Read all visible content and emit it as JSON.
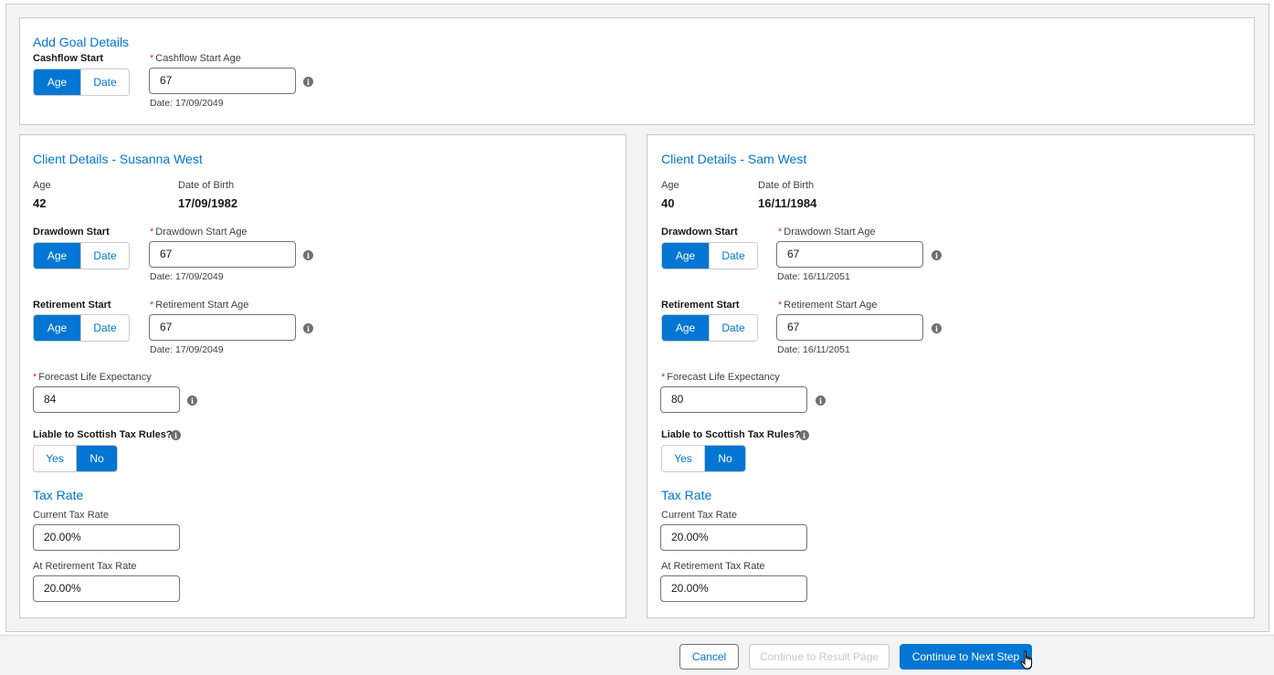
{
  "goal": {
    "title": "Add Goal Details",
    "cashflow_start_label": "Cashflow Start",
    "toggle": {
      "option1": "Age",
      "option2": "Date",
      "selected": "Age"
    },
    "age_label": "Cashflow Start Age",
    "age_value": "67",
    "date_hint": "Date: 17/09/2049"
  },
  "clients": [
    {
      "title": "Client Details - Susanna West",
      "age_label": "Age",
      "age": "42",
      "dob_label": "Date of Birth",
      "dob": "17/09/1982",
      "drawdown_label": "Drawdown Start",
      "drawdown_toggle": {
        "option1": "Age",
        "option2": "Date",
        "selected": "Age"
      },
      "drawdown_age_label": "Drawdown Start Age",
      "drawdown_age": "67",
      "drawdown_date_hint": "Date: 17/09/2049",
      "retirement_label": "Retirement Start",
      "retirement_toggle": {
        "option1": "Age",
        "option2": "Date",
        "selected": "Age"
      },
      "retirement_age_label": "Retirement Start Age",
      "retirement_age": "67",
      "retirement_date_hint": "Date: 17/09/2049",
      "life_expectancy_label": "Forecast Life Expectancy",
      "life_expectancy": "84",
      "scottish_label": "Liable to Scottish Tax Rules?",
      "scottish_toggle": {
        "option1": "Yes",
        "option2": "No",
        "selected": "No"
      },
      "tax_title": "Tax Rate",
      "current_tax_label": "Current Tax Rate",
      "current_tax": "20.00%",
      "retirement_tax_label": "At Retirement Tax Rate",
      "retirement_tax": "20.00%"
    },
    {
      "title": "Client Details - Sam West",
      "age_label": "Age",
      "age": "40",
      "dob_label": "Date of Birth",
      "dob": "16/11/1984",
      "drawdown_label": "Drawdown Start",
      "drawdown_toggle": {
        "option1": "Age",
        "option2": "Date",
        "selected": "Age"
      },
      "drawdown_age_label": "Drawdown Start Age",
      "drawdown_age": "67",
      "drawdown_date_hint": "Date: 16/11/2051",
      "retirement_label": "Retirement Start",
      "retirement_toggle": {
        "option1": "Age",
        "option2": "Date",
        "selected": "Age"
      },
      "retirement_age_label": "Retirement Start Age",
      "retirement_age": "67",
      "retirement_date_hint": "Date: 16/11/2051",
      "life_expectancy_label": "Forecast Life Expectancy",
      "life_expectancy": "80",
      "scottish_label": "Liable to Scottish Tax Rules?",
      "scottish_toggle": {
        "option1": "Yes",
        "option2": "No",
        "selected": "No"
      },
      "tax_title": "Tax Rate",
      "current_tax_label": "Current Tax Rate",
      "current_tax": "20.00%",
      "retirement_tax_label": "At Retirement Tax Rate",
      "retirement_tax": "20.00%"
    }
  ],
  "required_mark": "*",
  "info_glyph": "i",
  "footer": {
    "cancel": "Cancel",
    "result_page": "Continue to Result Page",
    "next_step": "Continue to Next Step"
  },
  "colors": {
    "brand": "#0176d3",
    "required": "#c23934"
  }
}
